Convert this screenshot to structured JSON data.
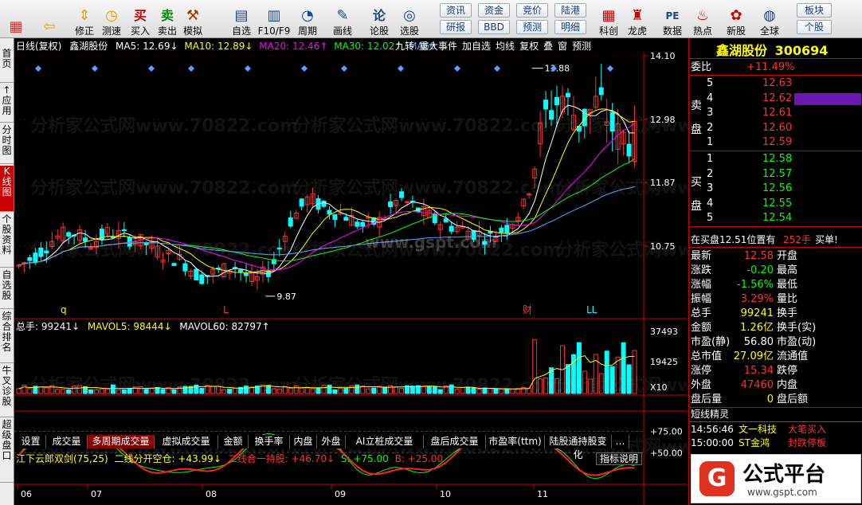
{
  "toolbar": {
    "buttons": [
      {
        "label": "",
        "icon": "grid-icon"
      },
      {
        "label": "",
        "icon": "back-arrow-icon"
      },
      {
        "label": "修正",
        "icon": "up-down-arrows-icon"
      },
      {
        "label": "测速",
        "icon": "clock-icon"
      },
      {
        "label": "买入",
        "icon": "buy-icon",
        "glyph": "买"
      },
      {
        "label": "卖出",
        "icon": "sell-icon",
        "glyph": "卖"
      },
      {
        "label": "模拟",
        "icon": "hammer-icon"
      },
      {
        "label": "自选",
        "icon": "folder-icon"
      },
      {
        "label": "F10/F9",
        "icon": "f10-icon"
      },
      {
        "label": "周期",
        "icon": "period-icon"
      },
      {
        "label": "画线",
        "icon": "pencil-icon"
      },
      {
        "label": "论股",
        "icon": "discuss-icon",
        "glyph": "论"
      },
      {
        "label": "选股",
        "icon": "magnifier-icon"
      },
      {
        "label": "科创",
        "icon": "chart-icon"
      },
      {
        "label": "龙虎",
        "icon": "dragon-tiger-icon"
      },
      {
        "label": "数据",
        "icon": "pe-icon",
        "glyph": "PE"
      },
      {
        "label": "热点",
        "icon": "fire-icon"
      },
      {
        "label": "新股",
        "icon": "new-stock-icon"
      },
      {
        "label": "全球",
        "icon": "globe-icon"
      }
    ],
    "small_buttons": [
      "资讯",
      "资金",
      "竞价",
      "陆港",
      "研报",
      "BBD",
      "预测",
      "明细",
      "板块",
      "个股"
    ]
  },
  "vtabs": [
    "首页",
    "↑应用",
    "分时图",
    "K线图",
    "个股资料",
    "自选股",
    "综合排名",
    "牛叉诊股",
    "超级盘口"
  ],
  "chart": {
    "header": {
      "period": "日线(复权)",
      "stock": "鑫湖股份",
      "ma5": "MA5: 12.69↓",
      "ma10": "MA10: 12.89↓",
      "ma20": "MA20: 12.46↑",
      "ma30": "MA30: 12.02↑",
      "ma60": "MA60",
      "tools": [
        "九转",
        "重大事件",
        "加自选",
        "均线",
        "复权",
        "叠",
        "窗",
        "预测"
      ]
    },
    "price_axis": [
      "14.10",
      "12.98",
      "11.87",
      "10.75"
    ],
    "high_label": "13.88",
    "low_label": "9.87",
    "event_marks": [
      "q",
      "L",
      "财",
      "LL"
    ],
    "watermark": "分析家公式网www.70822.com",
    "site_mark": "www.gspt.com",
    "volume": {
      "total": "总手: 99241↓",
      "mavol5": "MAVOL5: 98444↓",
      "mavol60": "MAVOL60: 82797↑",
      "axis": [
        "37493",
        "19425",
        "X10"
      ]
    },
    "bottom_tabs": [
      "设置",
      "成交量",
      "多周期成交量",
      "虚拟成交量",
      "金额",
      "换手率",
      "内盘",
      "外盘",
      "AI立桩成交量",
      "盘后成交量",
      "市盈率(ttm)",
      "陆股通持股变化",
      "…"
    ],
    "indicator": {
      "name": "江下云郎双剑(75,25)",
      "line2": "二线分开空仓: +43.99↓",
      "line3": "二线合一持股: +46.70↓",
      "s": "S: +75.00",
      "b": "B: +25.00",
      "help": "指标说明",
      "axis": [
        "+75.00",
        "+50.00"
      ]
    },
    "months": [
      "06",
      "07",
      "08",
      "09",
      "10",
      "11"
    ]
  },
  "right_panel": {
    "name": "鑫湖股份",
    "code": "300694",
    "weibi_label": "委比",
    "weibi": "+11.49%",
    "sell_label": "卖盘",
    "buy_label": "买盘",
    "asks": [
      {
        "lvl": "5",
        "price": "12.63"
      },
      {
        "lvl": "4",
        "price": "12.62"
      },
      {
        "lvl": "3",
        "price": "12.61"
      },
      {
        "lvl": "2",
        "price": "12.60"
      },
      {
        "lvl": "1",
        "price": "12.59"
      }
    ],
    "bids": [
      {
        "lvl": "1",
        "price": "12.58"
      },
      {
        "lvl": "2",
        "price": "12.57"
      },
      {
        "lvl": "3",
        "price": "12.56"
      },
      {
        "lvl": "4",
        "price": "12.55"
      },
      {
        "lvl": "5",
        "price": "12.54"
      }
    ],
    "position_note": "在买盘12.51位置有",
    "position_qty": "252手",
    "position_single": "买单!",
    "quote": [
      {
        "k": "最新",
        "v": "12.58",
        "k2": "开盘"
      },
      {
        "k": "涨跌",
        "v": "-0.20",
        "k2": "最高"
      },
      {
        "k": "涨幅",
        "v": "-1.56%",
        "k2": "最低"
      },
      {
        "k": "振幅",
        "v": "3.29%",
        "k2": "量比"
      },
      {
        "k": "总手",
        "v": "99241",
        "k2": "换手"
      },
      {
        "k": "金额",
        "v": "1.26亿",
        "k2": "换手(实)"
      },
      {
        "k": "市盈(静)",
        "v": "56.80",
        "k2": "市盈(动)"
      },
      {
        "k": "总市值",
        "v": "27.09亿",
        "k2": "流通值"
      },
      {
        "k": "涨停",
        "v": "15.34",
        "k2": "跌停"
      },
      {
        "k": "外盘",
        "v": "47460",
        "k2": "内盘"
      },
      {
        "k": "盘后量",
        "v": "0",
        "k2": "盘后额"
      }
    ],
    "short_title": "短线精灵",
    "short_list": [
      {
        "time": "14:56:46",
        "name": "文一科技",
        "event": "大笔买入"
      },
      {
        "time": "15:00:00",
        "name": "ST金鸿",
        "event": "封跌停板"
      }
    ],
    "logo_text": "公式平台",
    "logo_url": "www.gspt.com"
  },
  "colors": {
    "up": "#ff3030",
    "down": "#00ffff",
    "ma5": "#ffffff",
    "ma10": "#ffff00",
    "ma20": "#ff00ff",
    "ma30": "#00ff00",
    "ma60": "#5aa0ff"
  }
}
